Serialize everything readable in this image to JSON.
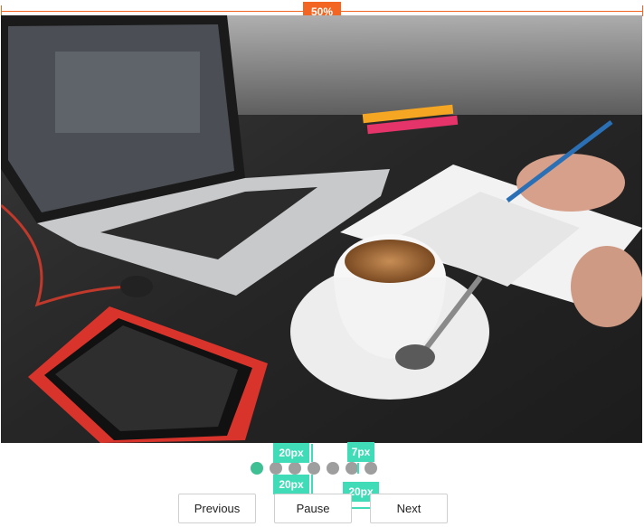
{
  "ruler": {
    "label": "50%",
    "color": "#f26522"
  },
  "slide": {
    "description_icon": "image-icon"
  },
  "pager": {
    "count": 7,
    "active_index": 0,
    "active_color": "#3fbf94",
    "inactive_color": "#9e9e9e"
  },
  "measurements": {
    "dot_to_top_gap": "20px",
    "dot_spacing": "7px",
    "dot_to_button_gap": "20px",
    "button_spacing": "20px",
    "color": "#3fdcb7"
  },
  "controls": {
    "previous_label": "Previous",
    "pause_label": "Pause",
    "next_label": "Next"
  }
}
